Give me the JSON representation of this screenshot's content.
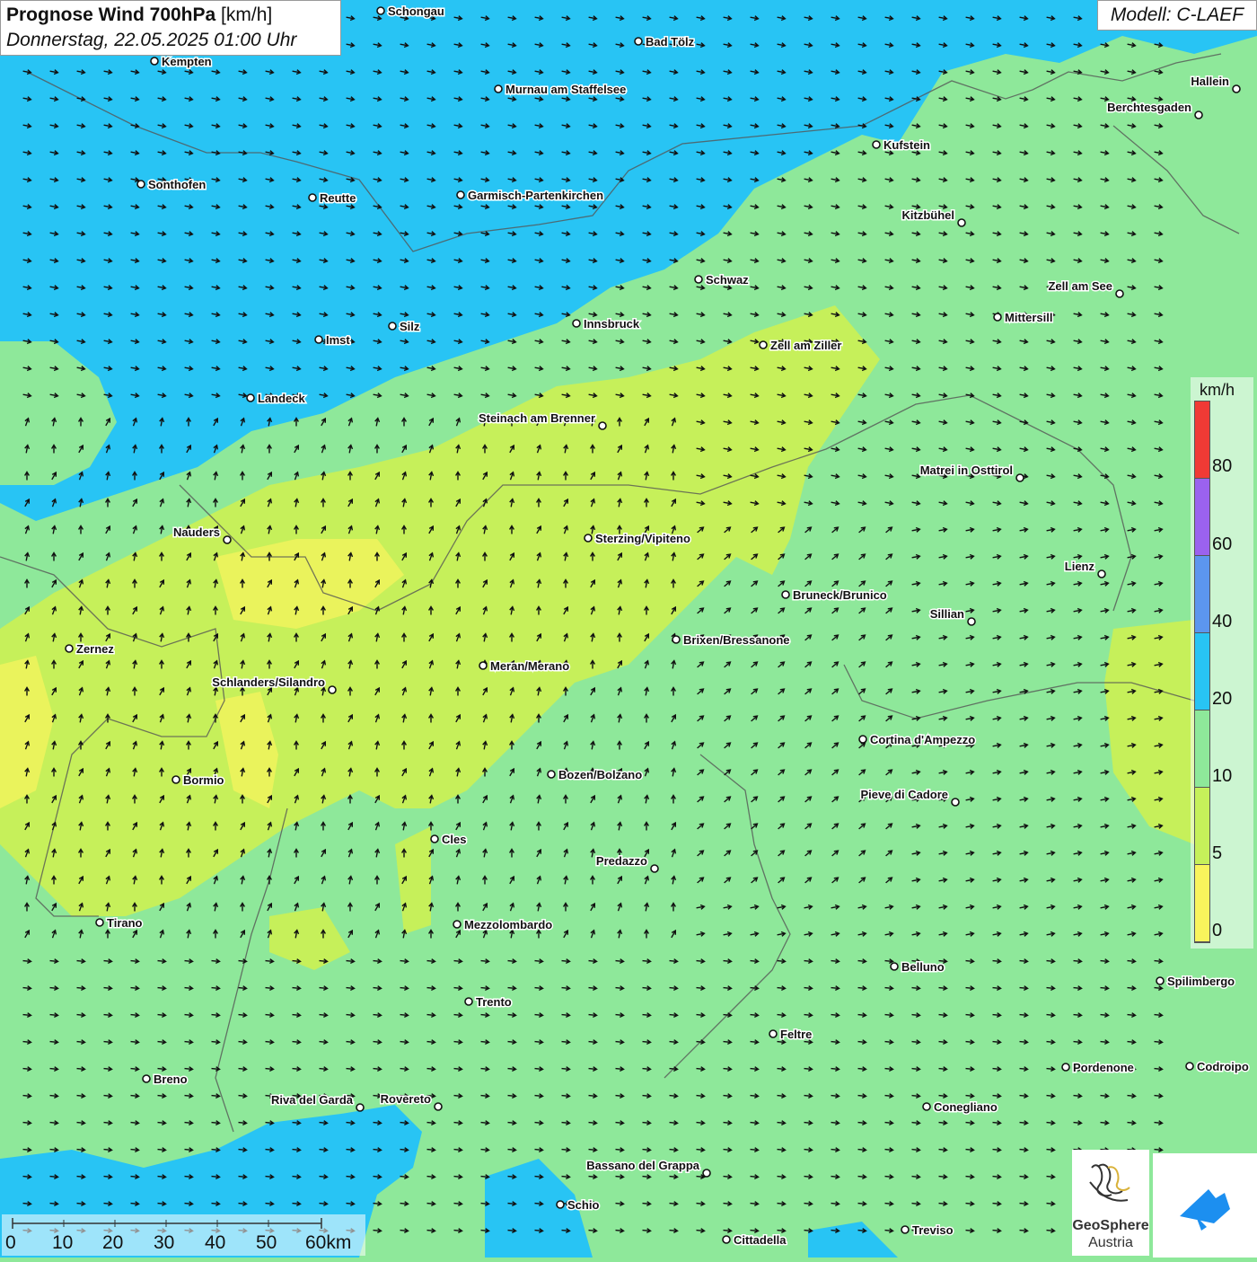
{
  "header": {
    "title_bold": "Prognose Wind 700hPa",
    "title_unit": "[km/h]",
    "datetime": "Donnerstag, 22.05.2025 01:00 Uhr",
    "model": "Modell: C-LAEF"
  },
  "legend": {
    "unit": "km/h",
    "labels": [
      "80",
      "60",
      "40",
      "20",
      "10",
      "5",
      "0"
    ],
    "colors": [
      "#f03a35",
      "#9b62ee",
      "#5c96ee",
      "#28c4f4",
      "#8ee89a",
      "#c6f05a",
      "#f9f45c"
    ]
  },
  "scale_bar": {
    "labels": [
      "0",
      "10",
      "20",
      "30",
      "40",
      "50",
      "60km"
    ]
  },
  "logo": {
    "name": "GeoSphere",
    "country": "Austria"
  },
  "cities": [
    {
      "name": "Schongau",
      "icon": "city-marker"
    },
    {
      "name": "Bad Tölz",
      "icon": "city-marker"
    },
    {
      "name": "Kempten",
      "icon": "city-marker"
    },
    {
      "name": "Murnau am Staffelsee",
      "icon": "city-marker"
    },
    {
      "name": "Hallein",
      "icon": "city-marker"
    },
    {
      "name": "Berchtesgaden",
      "icon": "city-marker"
    },
    {
      "name": "Kufstein",
      "icon": "city-marker"
    },
    {
      "name": "Sonthofen",
      "icon": "city-marker"
    },
    {
      "name": "Reutte",
      "icon": "city-marker"
    },
    {
      "name": "Garmisch-Partenkirchen",
      "icon": "city-marker"
    },
    {
      "name": "Kitzbühel",
      "icon": "city-marker"
    },
    {
      "name": "Schwaz",
      "icon": "city-marker"
    },
    {
      "name": "Zell am See",
      "icon": "city-marker"
    },
    {
      "name": "Mittersill",
      "icon": "city-marker"
    },
    {
      "name": "Innsbruck",
      "icon": "city-marker"
    },
    {
      "name": "Silz",
      "icon": "city-marker"
    },
    {
      "name": "Imst",
      "icon": "city-marker"
    },
    {
      "name": "Zell am Ziller",
      "icon": "city-marker"
    },
    {
      "name": "Landeck",
      "icon": "city-marker"
    },
    {
      "name": "Steinach am Brenner",
      "icon": "city-marker"
    },
    {
      "name": "Matrei in Osttirol",
      "icon": "city-marker"
    },
    {
      "name": "Nauders",
      "icon": "city-marker"
    },
    {
      "name": "Sterzing/Vipiteno",
      "icon": "city-marker"
    },
    {
      "name": "Lienz",
      "icon": "city-marker"
    },
    {
      "name": "Bruneck/Brunico",
      "icon": "city-marker"
    },
    {
      "name": "Sillian",
      "icon": "city-marker"
    },
    {
      "name": "Zernez",
      "icon": "city-marker"
    },
    {
      "name": "Brixen/Bressanone",
      "icon": "city-marker"
    },
    {
      "name": "Meran/Merano",
      "icon": "city-marker"
    },
    {
      "name": "Schlanders/Silandro",
      "icon": "city-marker"
    },
    {
      "name": "Cortina d'Ampezzo",
      "icon": "city-marker"
    },
    {
      "name": "Bozen/Bolzano",
      "icon": "city-marker"
    },
    {
      "name": "Bormio",
      "icon": "city-marker"
    },
    {
      "name": "Pieve di Cadore",
      "icon": "city-marker"
    },
    {
      "name": "Cles",
      "icon": "city-marker"
    },
    {
      "name": "Predazzo",
      "icon": "city-marker"
    },
    {
      "name": "Tirano",
      "icon": "city-marker"
    },
    {
      "name": "Mezzolombardo",
      "icon": "city-marker"
    },
    {
      "name": "Belluno",
      "icon": "city-marker"
    },
    {
      "name": "Spilimbergo",
      "icon": "city-marker"
    },
    {
      "name": "Trento",
      "icon": "city-marker"
    },
    {
      "name": "Feltre",
      "icon": "city-marker"
    },
    {
      "name": "Breno",
      "icon": "city-marker"
    },
    {
      "name": "Pordenone",
      "icon": "city-marker"
    },
    {
      "name": "Codroipo",
      "icon": "city-marker"
    },
    {
      "name": "Riva del Garda",
      "icon": "city-marker"
    },
    {
      "name": "Rovereto",
      "icon": "city-marker"
    },
    {
      "name": "Conegliano",
      "icon": "city-marker"
    },
    {
      "name": "Bassano del Grappa",
      "icon": "city-marker"
    },
    {
      "name": "Schio",
      "icon": "city-marker"
    },
    {
      "name": "Treviso",
      "icon": "city-marker"
    },
    {
      "name": "Cittadella",
      "icon": "city-marker"
    }
  ]
}
